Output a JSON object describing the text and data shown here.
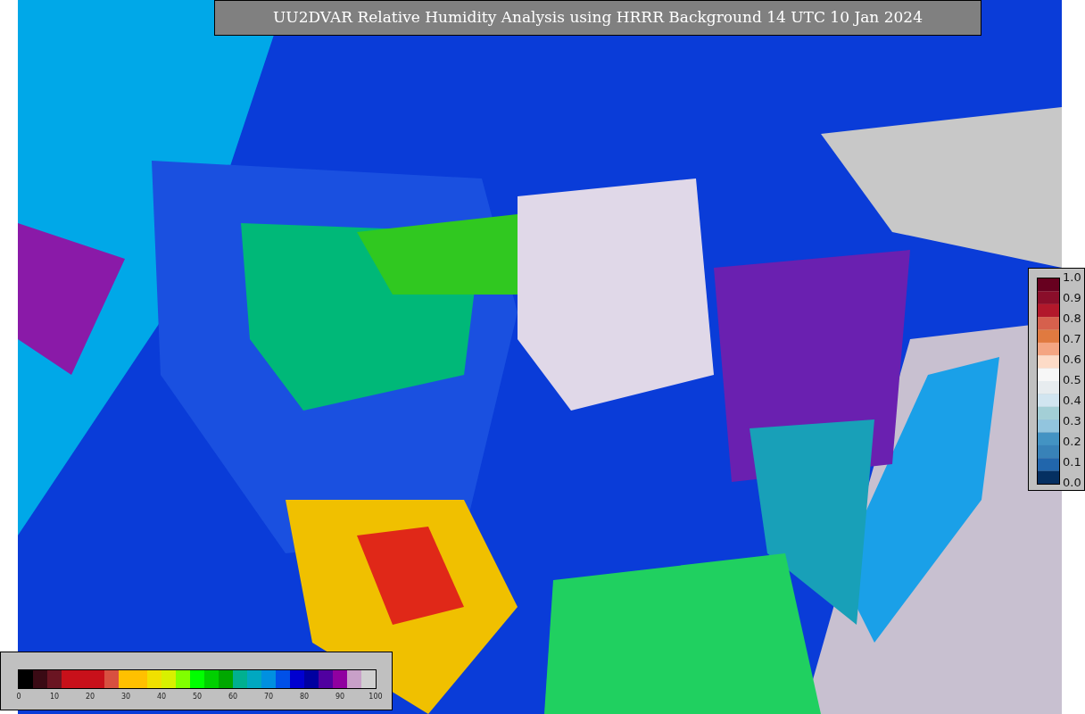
{
  "title": "UU2DVAR Relative Humidity Analysis using HRRR Background 14 UTC 10 Jan 2024",
  "humidity_scale": {
    "ticks": [
      "0",
      "10",
      "20",
      "30",
      "40",
      "50",
      "60",
      "70",
      "80",
      "90",
      "100"
    ]
  },
  "value_scale": {
    "ticks": [
      "1.0",
      "0.9",
      "0.8",
      "0.7",
      "0.6",
      "0.5",
      "0.4",
      "0.3",
      "0.2",
      "0.1",
      "0.0"
    ]
  }
}
